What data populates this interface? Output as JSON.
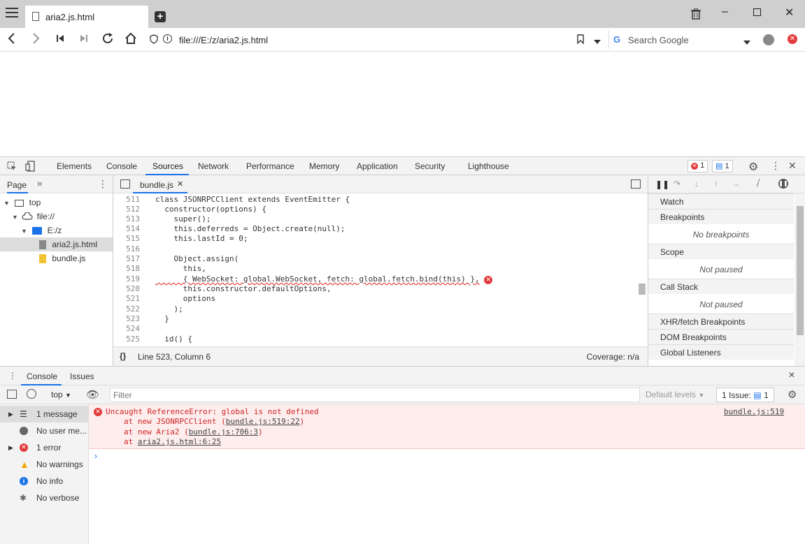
{
  "browser": {
    "tab_title": "aria2.js.html",
    "url": "file:///E:/z/aria2.js.html",
    "search_placeholder": "Search Google"
  },
  "devtools": {
    "tabs": [
      "Elements",
      "Console",
      "Sources",
      "Network",
      "Performance",
      "Memory",
      "Application",
      "Security",
      "Lighthouse"
    ],
    "active_tab": "Sources",
    "error_count": "1",
    "message_count": "1"
  },
  "navigator": {
    "tab_label": "Page",
    "tree": [
      {
        "label": "top",
        "level": 0
      },
      {
        "label": "file://",
        "level": 1
      },
      {
        "label": "E:/z",
        "level": 2
      },
      {
        "label": "aria2.js.html",
        "level": 3,
        "selected": true
      },
      {
        "label": "bundle.js",
        "level": 3
      }
    ]
  },
  "editor": {
    "file_tab": "bundle.js",
    "status_position": "Line 523, Column 6",
    "coverage": "Coverage: n/a",
    "lines": [
      {
        "n": "511",
        "code": "class JSONRPCClient extends EventEmitter {"
      },
      {
        "n": "512",
        "code": "  constructor(options) {"
      },
      {
        "n": "513",
        "code": "    super();"
      },
      {
        "n": "514",
        "code": "    this.deferreds = Object.create(null);"
      },
      {
        "n": "515",
        "code": "    this.lastId = 0;"
      },
      {
        "n": "516",
        "code": ""
      },
      {
        "n": "517",
        "code": "    Object.assign("
      },
      {
        "n": "518",
        "code": "      this,"
      },
      {
        "n": "519",
        "code": "      { WebSocket: global.WebSocket, fetch: global.fetch.bind(this) },"
      },
      {
        "n": "520",
        "code": "      this.constructor.defaultOptions,"
      },
      {
        "n": "521",
        "code": "      options"
      },
      {
        "n": "522",
        "code": "    );"
      },
      {
        "n": "523",
        "code": "  }"
      },
      {
        "n": "524",
        "code": ""
      },
      {
        "n": "525",
        "code": "  id() {"
      }
    ]
  },
  "debugger": {
    "sections": [
      {
        "title": "Watch"
      },
      {
        "title": "Breakpoints",
        "empty": "No breakpoints"
      },
      {
        "title": "Scope",
        "empty": "Not paused"
      },
      {
        "title": "Call Stack",
        "empty": "Not paused"
      },
      {
        "title": "XHR/fetch Breakpoints"
      },
      {
        "title": "DOM Breakpoints"
      },
      {
        "title": "Global Listeners"
      }
    ]
  },
  "console": {
    "tabs": [
      "Console",
      "Issues"
    ],
    "context": "top",
    "filter_placeholder": "Filter",
    "levels": "Default levels",
    "issues_label": "1 Issue:",
    "issues_count": "1",
    "sidebar": [
      {
        "label": "1 message",
        "icon": "list-icon"
      },
      {
        "label": "No user me...",
        "icon": "user-icon"
      },
      {
        "label": "1 error",
        "icon": "error-icon"
      },
      {
        "label": "No warnings",
        "icon": "warning-icon"
      },
      {
        "label": "No info",
        "icon": "info-icon"
      },
      {
        "label": "No verbose",
        "icon": "bug-icon"
      }
    ],
    "error": {
      "message": "Uncaught ReferenceError: global is not defined",
      "source": "bundle.js:519",
      "stack": [
        {
          "prefix": "at new JSONRPCClient (",
          "link": "bundle.js:519:22",
          "suffix": ")"
        },
        {
          "prefix": "at new Aria2 (",
          "link": "bundle.js:706:3",
          "suffix": ")"
        },
        {
          "prefix": "at ",
          "link": "aria2.js.html:6:25",
          "suffix": ""
        }
      ]
    }
  }
}
